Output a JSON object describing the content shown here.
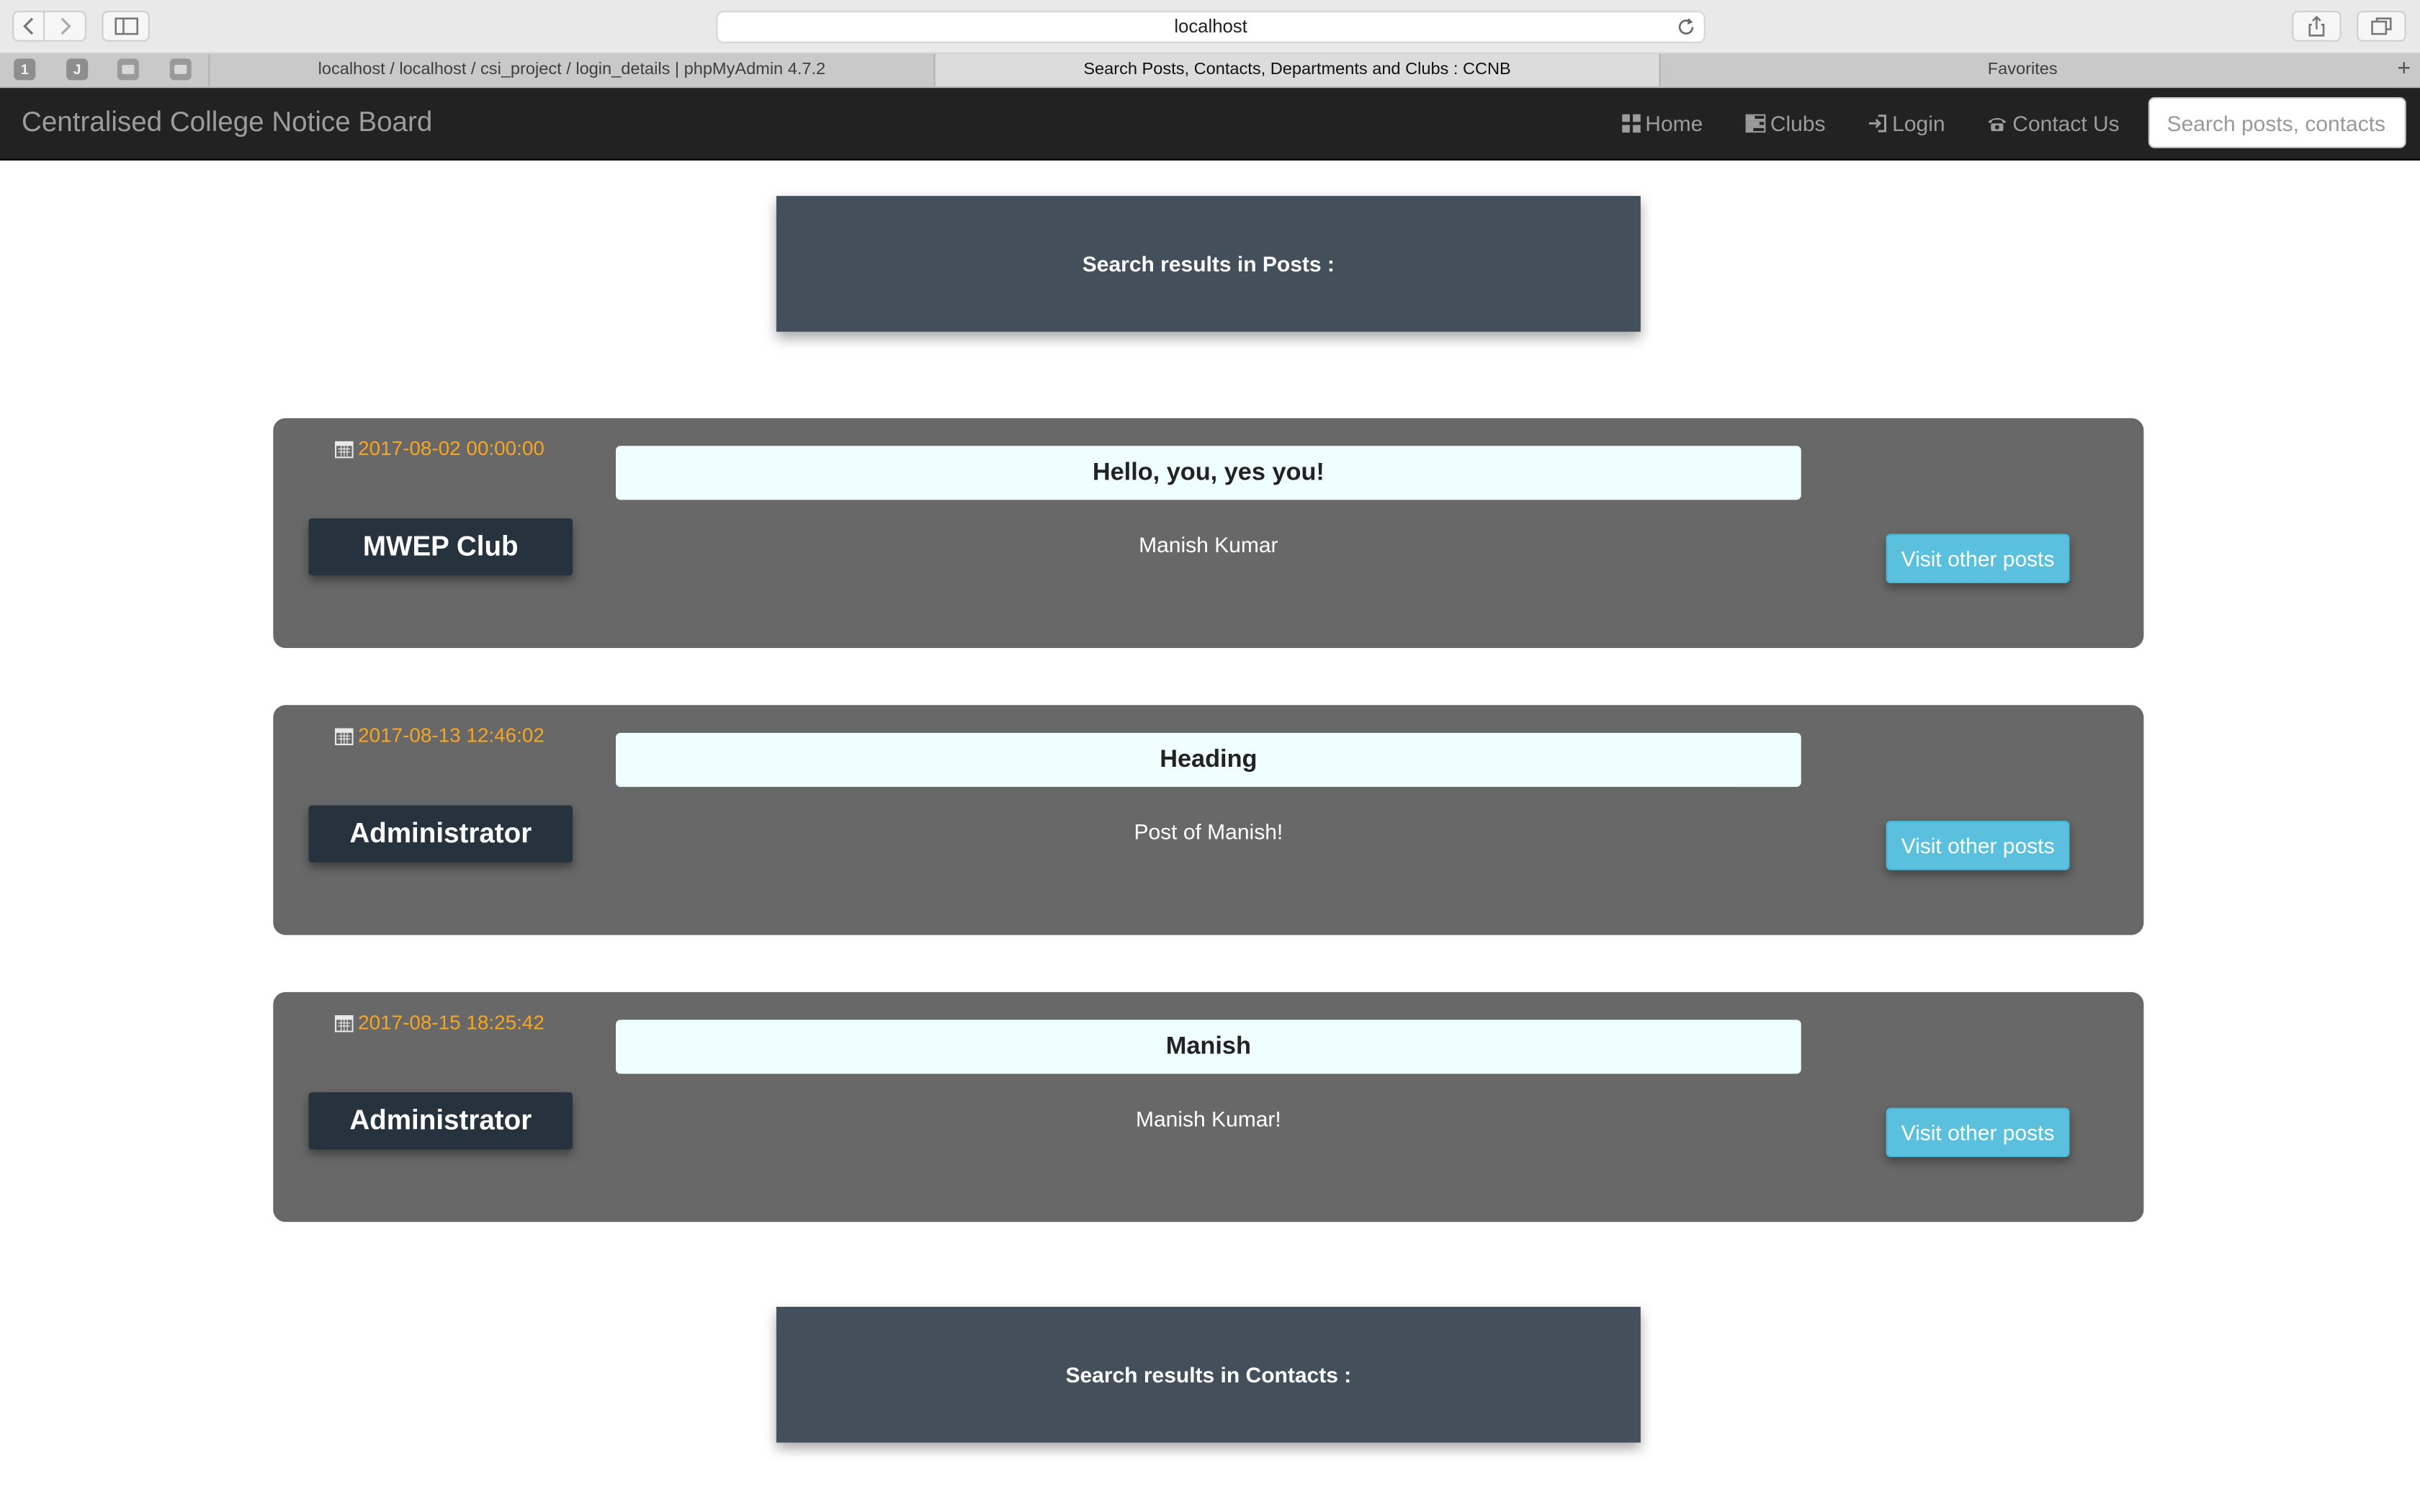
{
  "browser": {
    "address": "localhost",
    "pinned_tabs": [
      "1",
      "J",
      "",
      ""
    ],
    "tabs": [
      {
        "label": "localhost / localhost / csi_project / login_details | phpMyAdmin 4.7.2",
        "active": false
      },
      {
        "label": "Search Posts, Contacts, Departments and Clubs : CCNB",
        "active": true
      },
      {
        "label": "Favorites",
        "active": false
      }
    ],
    "new_tab": "+"
  },
  "navbar": {
    "brand": "Centralised College Notice Board",
    "items": [
      {
        "label": "Home",
        "icon": "th-large-icon"
      },
      {
        "label": "Clubs",
        "icon": "tasks-icon"
      },
      {
        "label": "Login",
        "icon": "log-in-icon"
      },
      {
        "label": "Contact Us",
        "icon": "phone-icon"
      }
    ],
    "search_placeholder": "Search posts, contacts, departments and clubs"
  },
  "sections": {
    "posts_heading": "Search results in Posts :",
    "contacts_heading": "Search results in Contacts :"
  },
  "posts": [
    {
      "date": "2017-08-02 00:00:00",
      "author": "MWEP Club",
      "title": "Hello, you, yes you!",
      "body": "Manish Kumar",
      "button": "Visit other posts"
    },
    {
      "date": "2017-08-13 12:46:02",
      "author": "Administrator",
      "title": "Heading",
      "body": "Post of Manish!",
      "button": "Visit other posts"
    },
    {
      "date": "2017-08-15 18:25:42",
      "author": "Administrator",
      "title": "Manish",
      "body": "Manish Kumar!",
      "button": "Visit other posts"
    }
  ],
  "colors": {
    "navbar_bg": "#222222",
    "section_head_bg": "#434f5a",
    "post_bg": "#686868",
    "date_color": "#f5a623",
    "button_bg": "#5bc0de"
  }
}
